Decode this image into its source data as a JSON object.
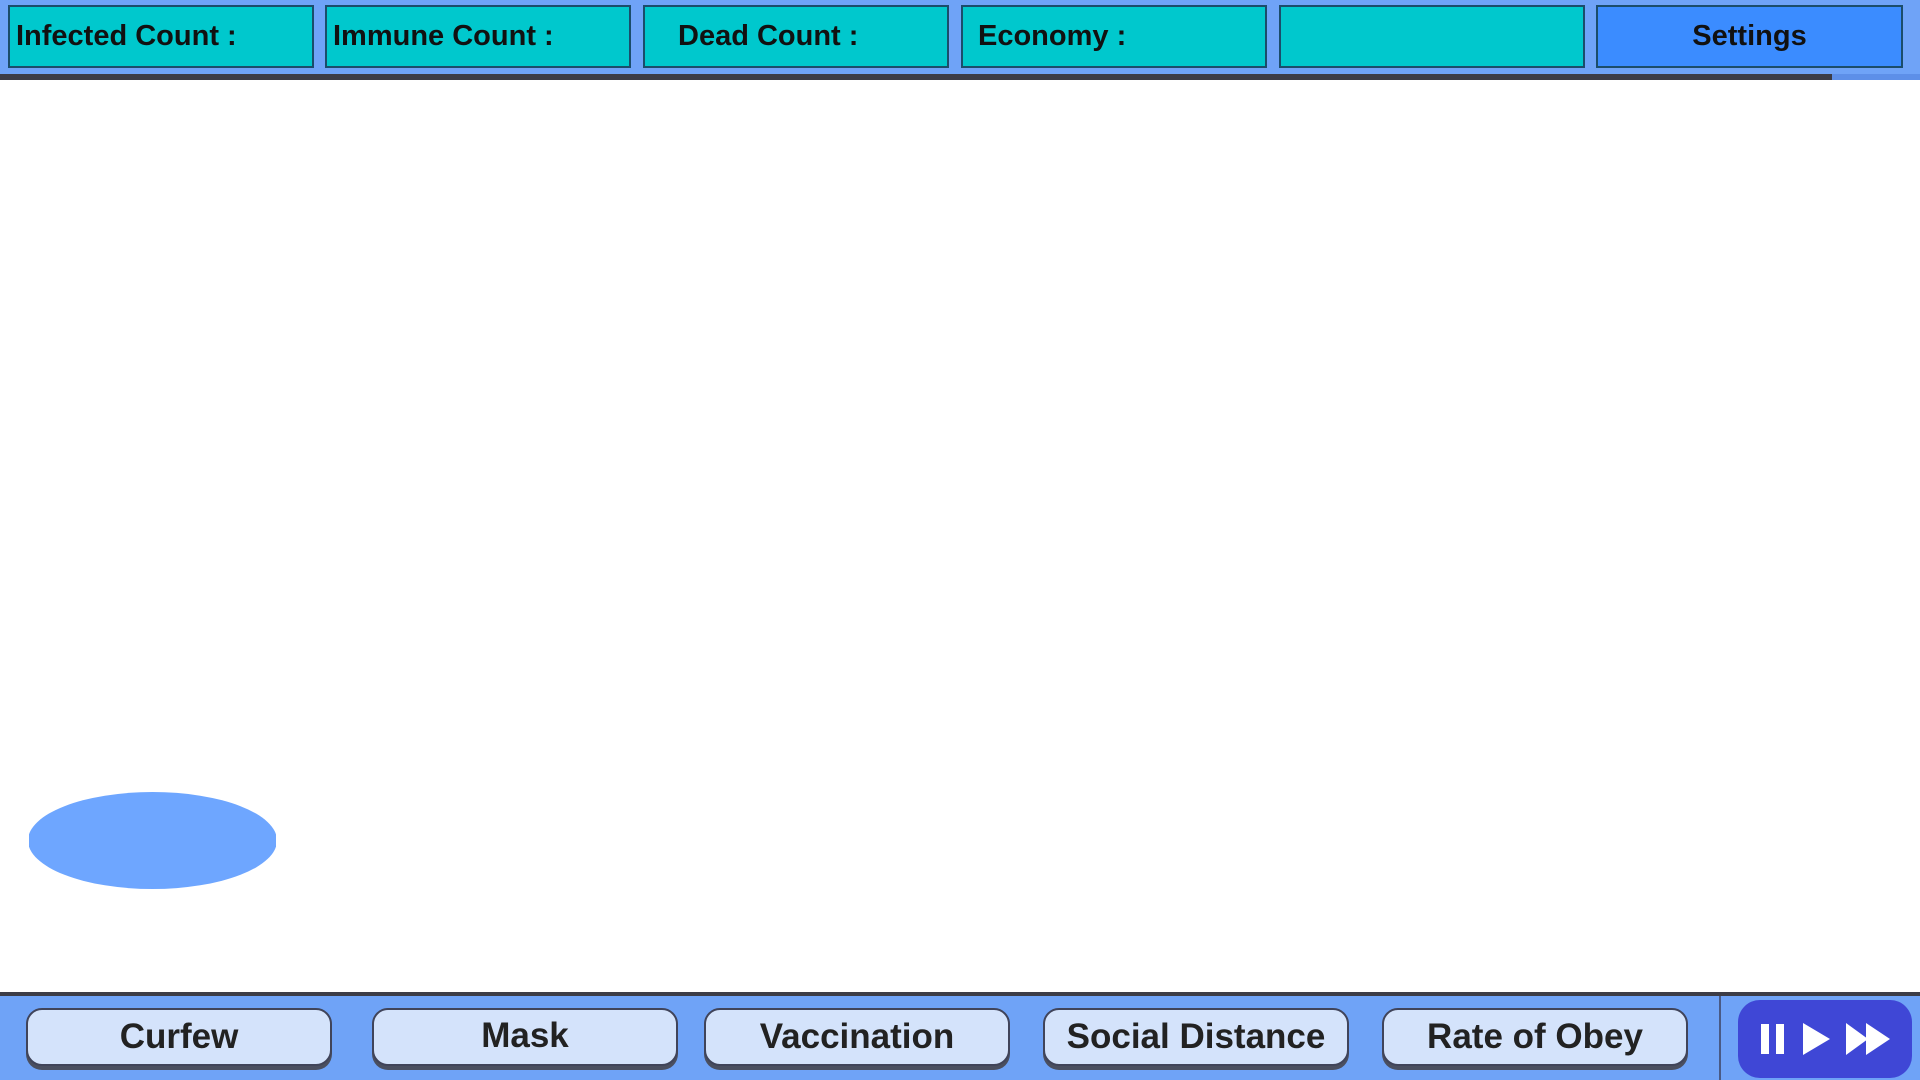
{
  "stats": {
    "infected_label": "Infected Count :",
    "immune_label": "Immune Count :",
    "dead_label": "Dead Count :",
    "economy_label": "Economy :",
    "blank_label": ""
  },
  "header": {
    "settings_label": "Settings"
  },
  "policies": {
    "curfew_label": "Curfew",
    "mask_label": "Mask",
    "vaccination_label": "Vaccination",
    "social_distance_label": "Social Distance",
    "rate_of_obey_label": "Rate of Obey"
  },
  "controls": {
    "icons": [
      "pause-icon",
      "play-icon",
      "fast-forward-icon"
    ]
  },
  "colors": {
    "bar_background": "#6fa3f7",
    "stat_panel": "#00c8cd",
    "settings_button": "#3b8cff",
    "policy_button": "#d4e3fb",
    "speed_panel": "#3f47d6",
    "zone": "#6ea6ff"
  }
}
